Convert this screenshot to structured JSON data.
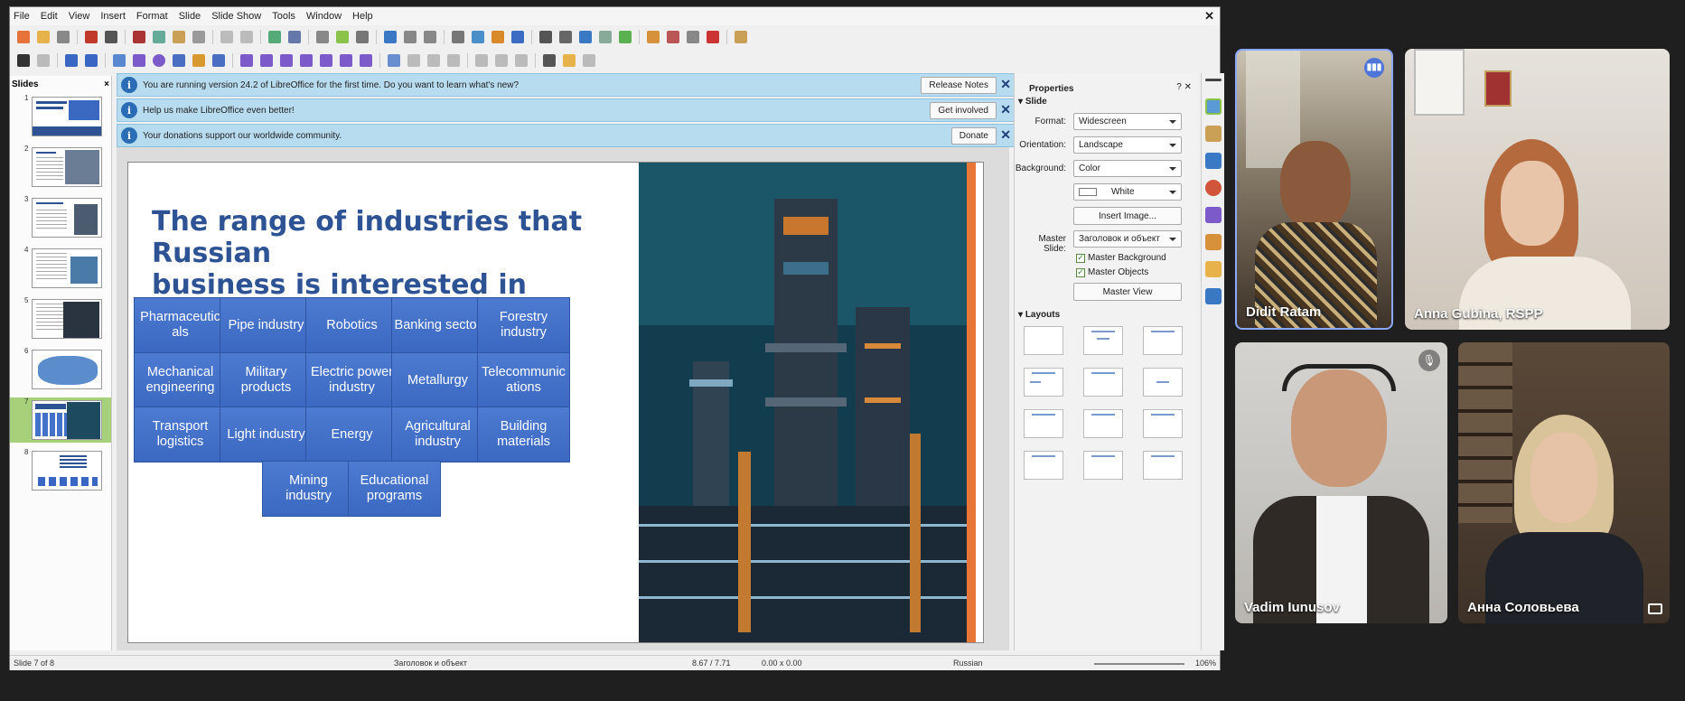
{
  "menubar": [
    "File",
    "Edit",
    "View",
    "Insert",
    "Format",
    "Slide",
    "Slide Show",
    "Tools",
    "Window",
    "Help"
  ],
  "slides_panel": {
    "title": "Slides",
    "close": "×",
    "numbers": [
      "1",
      "2",
      "3",
      "4",
      "5",
      "6",
      "7",
      "8"
    ],
    "selected": 7
  },
  "notices": [
    {
      "text": "You are running version 24.2 of LibreOffice for the first time. Do you want to learn what's new?",
      "button": "Release Notes"
    },
    {
      "text": "Help us make LibreOffice even better!",
      "button": "Get involved"
    },
    {
      "text": "Your donations support our worldwide community.",
      "button": "Donate"
    }
  ],
  "slide": {
    "title_lines": [
      "The range of industries that",
      "Russian",
      "business is interested in"
    ],
    "industries": [
      [
        "Pharmaceuticals",
        "Pipe industry",
        "Robotics",
        "Banking sector",
        "Forestry industry"
      ],
      [
        "Mechanical engineering",
        "Military products",
        "Electric power industry",
        "Metallurgy",
        "Telecommunications"
      ],
      [
        "Transport logistics",
        "Light industry",
        "Energy",
        "Agricultural industry",
        "Building materials"
      ],
      [
        "Mining industry",
        "Educational programs"
      ]
    ],
    "industry_display": {
      "Pharmaceuticals": "Pharmaceutic als",
      "Telecommunications": "Telecommunic ations"
    }
  },
  "properties": {
    "title": "Properties",
    "section_slide": "Slide",
    "format_label": "Format:",
    "format_value": "Widescreen",
    "orientation_label": "Orientation:",
    "orientation_value": "Landscape",
    "background_label": "Background:",
    "background_value": "Color",
    "color_value": "White",
    "insert_image": "Insert Image...",
    "master_slide_label": "Master Slide:",
    "master_slide_value": "Заголовок и объект",
    "master_background": "Master Background",
    "master_objects": "Master Objects",
    "master_view": "Master View",
    "section_layouts": "Layouts"
  },
  "statusbar": {
    "slide_info": "Slide 7 of 8",
    "layout": "Заголовок и объект",
    "position": "8.67 / 7.71",
    "size": "0.00 x 0.00",
    "language": "Russian",
    "zoom": "106%"
  },
  "participants": [
    {
      "name": "Didit Ratam",
      "speaking": true
    },
    {
      "name": "Anna Gubina, RSPP",
      "speaking": false
    },
    {
      "name": "Vadim Iunusov",
      "muted": true
    },
    {
      "name": "Анна Соловьева",
      "muted": false
    }
  ],
  "colors": {
    "title_blue": "#2e5394",
    "box_blue": "#4471c9",
    "accent_orange": "#e87636",
    "active_speaker": "#8aa8ff"
  }
}
